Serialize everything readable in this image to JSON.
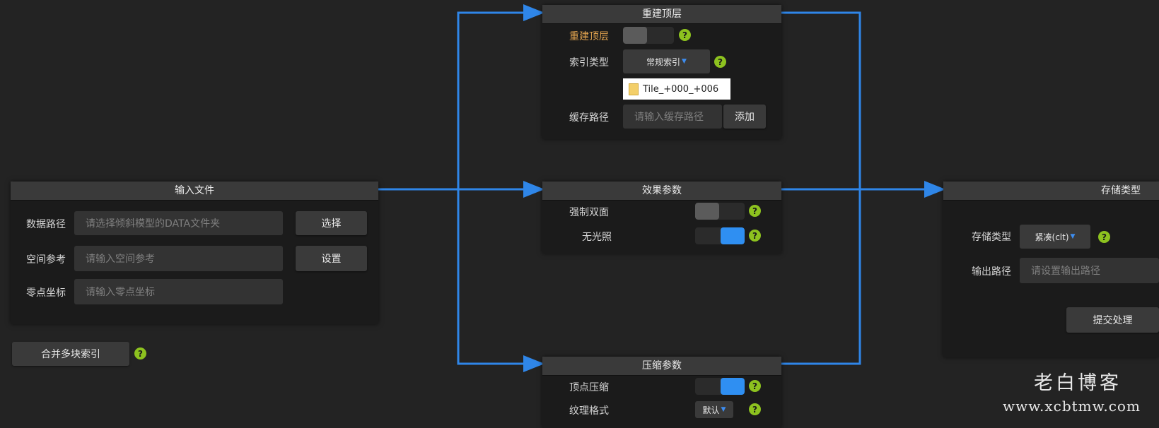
{
  "input_panel": {
    "title": "输入文件",
    "data_path": {
      "label": "数据路径",
      "placeholder": "请选择倾斜模型的DATA文件夹",
      "button": "选择"
    },
    "spatial_ref": {
      "label": "空间参考",
      "placeholder": "请输入空间参考",
      "button": "设置"
    },
    "origin": {
      "label": "零点坐标",
      "placeholder": "请输入零点坐标"
    }
  },
  "merge_button": {
    "label": "合并多块索引"
  },
  "rebuild_panel": {
    "title": "重建顶层",
    "rebuild": {
      "label": "重建顶层",
      "enabled": false
    },
    "index_type": {
      "label": "索引类型",
      "value": "常规索引"
    },
    "tile_item": "Tile_+000_+006",
    "cache_path": {
      "label": "缓存路径",
      "placeholder": "请输入缓存路径",
      "button": "添加"
    }
  },
  "effect_panel": {
    "title": "效果参数",
    "double_sided": {
      "label": "强制双面",
      "enabled": false
    },
    "no_lighting": {
      "label": "无光照",
      "enabled": true
    }
  },
  "compress_panel": {
    "title": "压缩参数",
    "vertex": {
      "label": "顶点压缩",
      "enabled": true
    },
    "texture": {
      "label": "纹理格式",
      "value": "默认"
    }
  },
  "storage_panel": {
    "title": "存储类型",
    "storage_type": {
      "label": "存储类型",
      "value": "紧凑(clt)"
    },
    "output_path": {
      "label": "输出路径",
      "placeholder": "请设置输出路径"
    },
    "submit": "提交处理"
  },
  "help_glyph": "?",
  "dropdown_caret": "▼",
  "watermark": {
    "name": "老白博客",
    "url": "www.xcbtmw.com"
  },
  "colors": {
    "wire": "#2f86e8",
    "toggle_on": "#2f8ff2",
    "help": "#8dc21f",
    "label_accent": "#e0a24e"
  }
}
